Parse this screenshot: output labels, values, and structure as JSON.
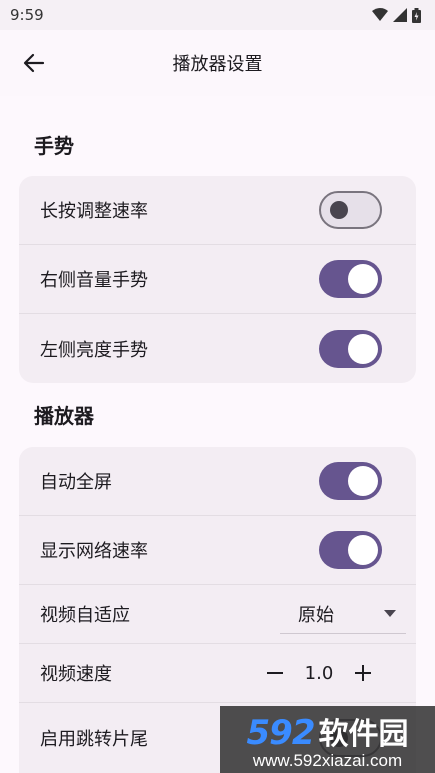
{
  "status_bar": {
    "time": "9:59"
  },
  "app_bar": {
    "title": "播放器设置"
  },
  "sections": [
    {
      "title": "手势",
      "rows": [
        {
          "label": "长按调整速率",
          "control": "toggle",
          "on": false
        },
        {
          "label": "右侧音量手势",
          "control": "toggle",
          "on": true
        },
        {
          "label": "左侧亮度手势",
          "control": "toggle",
          "on": true
        }
      ]
    },
    {
      "title": "播放器",
      "rows": [
        {
          "label": "自动全屏",
          "control": "toggle",
          "on": true
        },
        {
          "label": "显示网络速率",
          "control": "toggle",
          "on": true
        },
        {
          "label": "视频自适应",
          "control": "dropdown",
          "value": "原始"
        },
        {
          "label": "视频速度",
          "control": "stepper",
          "value": "1.0"
        },
        {
          "label": "启用跳转片尾",
          "control": "toggle",
          "on": false
        }
      ]
    }
  ],
  "watermark": {
    "number": "592",
    "brand": "软件园",
    "url": "www.592xiazai.com"
  },
  "colors": {
    "accent": "#66558f",
    "background": "#fdf8fd",
    "card": "#f3edf3"
  }
}
